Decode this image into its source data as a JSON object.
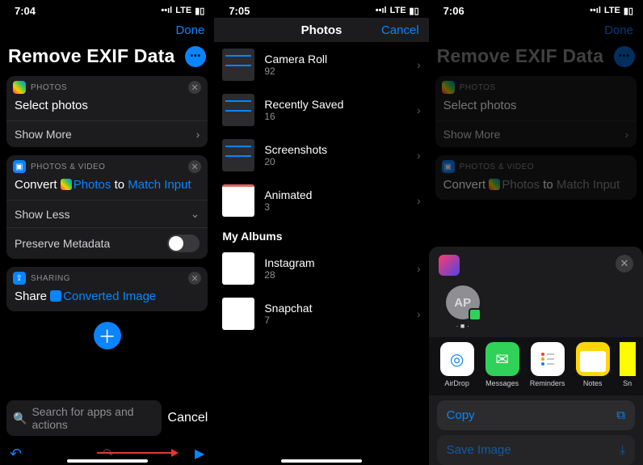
{
  "accent": "#0a84ff",
  "screen1": {
    "time": "7:04",
    "signal_label": "LTE",
    "nav_done": "Done",
    "title": "Remove EXIF Data",
    "card_photos": {
      "header": "PHOTOS",
      "body": "Select photos",
      "show_more": "Show More"
    },
    "card_convert": {
      "header": "PHOTOS & VIDEO",
      "prefix": "Convert",
      "token1": "Photos",
      "mid": "to",
      "token2": "Match Input",
      "show_less": "Show Less",
      "preserve": "Preserve Metadata"
    },
    "card_share": {
      "header": "SHARING",
      "prefix": "Share",
      "token": "Converted Image"
    },
    "search_placeholder": "Search for apps and actions",
    "cancel": "Cancel"
  },
  "screen2": {
    "time": "7:05",
    "signal_label": "LTE",
    "nav_title": "Photos",
    "nav_cancel": "Cancel",
    "albums": [
      {
        "name": "Camera Roll",
        "count": "92"
      },
      {
        "name": "Recently Saved",
        "count": "16"
      },
      {
        "name": "Screenshots",
        "count": "20"
      },
      {
        "name": "Animated",
        "count": "3"
      }
    ],
    "section": "My Albums",
    "my_albums": [
      {
        "name": "Instagram",
        "count": "28"
      },
      {
        "name": "Snapchat",
        "count": "7"
      }
    ]
  },
  "screen3": {
    "time": "7:06",
    "signal_label": "LTE",
    "nav_done": "Done",
    "title": "Remove EXIF Data",
    "card_photos_header": "PHOTOS",
    "card_photos_body": "Select photos",
    "card_photos_more": "Show More",
    "card_convert_header": "PHOTOS & VIDEO",
    "convert_prefix": "Convert",
    "convert_token1": "Photos",
    "convert_mid": "to",
    "convert_token2": "Match Input",
    "contact_initials": "AP",
    "contact_name": "· ■ ·",
    "apps": [
      {
        "name": "AirDrop"
      },
      {
        "name": "Messages"
      },
      {
        "name": "Reminders"
      },
      {
        "name": "Notes"
      },
      {
        "name": "Sn"
      }
    ],
    "action_copy": "Copy",
    "action_save": "Save Image"
  }
}
